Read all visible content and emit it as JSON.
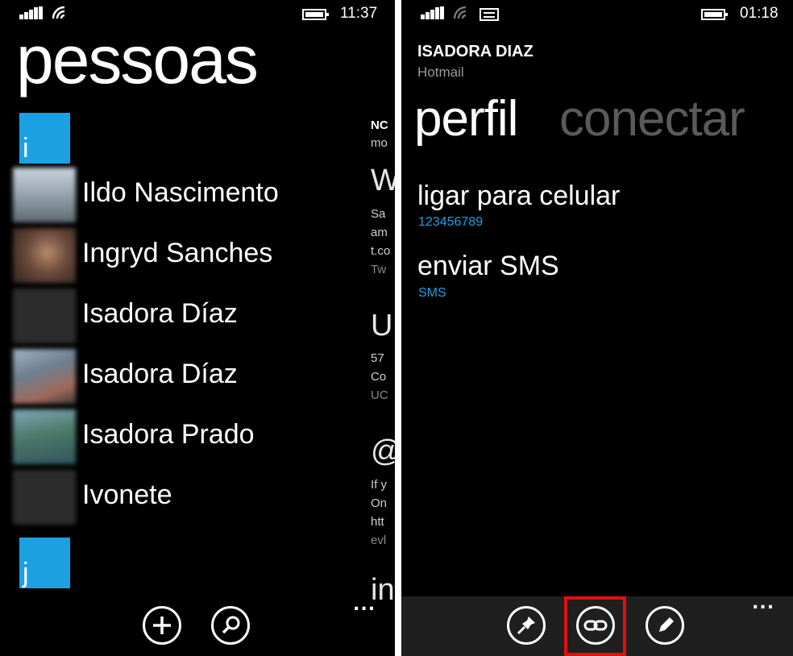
{
  "left_screen": {
    "status": {
      "time": "11:37",
      "icons": [
        "signal-icon",
        "wifi-icon",
        "battery-icon"
      ]
    },
    "title": "pessoas",
    "groups": [
      {
        "letter": "i",
        "contacts": [
          {
            "name": "Ildo Nascimento",
            "avatar": "photo"
          },
          {
            "name": "Ingryd Sanches",
            "avatar": "photo"
          },
          {
            "name": "Isadora Díaz",
            "avatar": "blank"
          },
          {
            "name": "Isadora Díaz",
            "avatar": "photo"
          },
          {
            "name": "Isadora Prado",
            "avatar": "photo"
          },
          {
            "name": "Ivonete",
            "avatar": "blank"
          }
        ]
      },
      {
        "letter": "j",
        "contacts": []
      }
    ],
    "peek_panel": {
      "lines": [
        "NC",
        "mo",
        "W",
        "Sa",
        "am",
        "t.co",
        "Tw",
        "U",
        "57",
        "Co",
        "UC",
        "@",
        "If y",
        "On",
        "htt",
        "evl",
        "in"
      ]
    },
    "appbar": {
      "buttons": [
        "add-icon",
        "search-icon"
      ],
      "more": "..."
    }
  },
  "right_screen": {
    "status": {
      "time": "01:18",
      "icons": [
        "signal-icon",
        "wifi-icon",
        "message-icon",
        "battery-icon"
      ]
    },
    "contact_name": "ISADORA DIAZ",
    "account": "Hotmail",
    "pivots": [
      {
        "label": "perfil",
        "active": true
      },
      {
        "label": "conectar",
        "active": false
      }
    ],
    "actions": [
      {
        "title": "ligar para celular",
        "subtitle": "123456789"
      },
      {
        "title": "enviar SMS",
        "subtitle": "SMS"
      }
    ],
    "appbar": {
      "buttons": [
        "pin-icon",
        "link-icon",
        "edit-icon"
      ],
      "highlighted": "link-icon",
      "more": "..."
    }
  },
  "colors": {
    "accent": "#1ba1e2",
    "highlight": "#e01010",
    "background": "#000000",
    "appbar": "#1f1f1f"
  }
}
